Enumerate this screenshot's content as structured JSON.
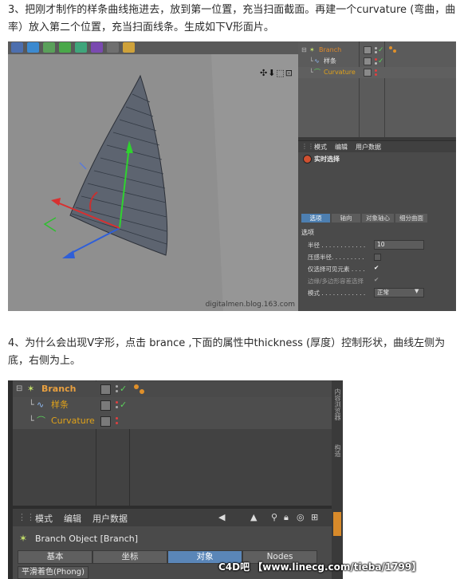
{
  "step3_text": "3、把刚才制作的样条曲线拖进去，放到第一位置，充当扫面截面。再建一个curvature (弯曲，曲率）放入第二个位置，充当扫面线条。生成如下V形面片。",
  "step4_text": "4、为什么会出现V字形，点击 brance ,下面的属性中thickness (厚度）控制形状，曲线左侧为底，右侧为上。",
  "screenshot1": {
    "viewport_icons": "✣⬇⬚⊡",
    "watermark": "digitalmen.blog.163.com",
    "objects": [
      {
        "name": "Branch",
        "color": "#e08a2a"
      },
      {
        "name": "样条",
        "color": "#e6e6e6"
      },
      {
        "name": "Curvature",
        "color": "#e0a21a"
      }
    ],
    "attr_menu": [
      "模式",
      "编辑",
      "用户数据"
    ],
    "attr_title": "实时选择",
    "tabs": [
      "选项",
      "轴向",
      "对象轴心",
      "细分曲面"
    ],
    "active_tab": "选项",
    "section": "选项",
    "props": [
      {
        "label": "半径 . . . . . . . . . . . .",
        "value": "10",
        "type": "field"
      },
      {
        "label": "压感半径. . . . . . . . .",
        "value": "",
        "type": "checkbox"
      },
      {
        "label": "仅选择可见元素 . . . .",
        "value": "✔",
        "type": "check"
      },
      {
        "label": "边缘/多边形容差选择",
        "value": "✔",
        "type": "check"
      },
      {
        "label": "模式 . . . . . . . . . . . .",
        "value": "正常",
        "type": "dropdown"
      }
    ]
  },
  "screenshot2": {
    "objects": [
      {
        "name": "Branch",
        "color": "#e8a040"
      },
      {
        "name": "样条",
        "color": "#e0a21a"
      },
      {
        "name": "Curvature",
        "color": "#e0a21a"
      }
    ],
    "side_tabs": [
      "内容浏览器",
      "构造"
    ],
    "attr_menu": [
      "模式",
      "编辑",
      "用户数据"
    ],
    "attr_title": "Branch Object [Branch]",
    "tabs": [
      "基本",
      "坐标",
      "对象",
      "Nodes"
    ],
    "active_tab": "对象",
    "shading": "平滑着色(Phong)",
    "watermark": "C4D吧 【www.linecg.com/tieba/1799】"
  }
}
